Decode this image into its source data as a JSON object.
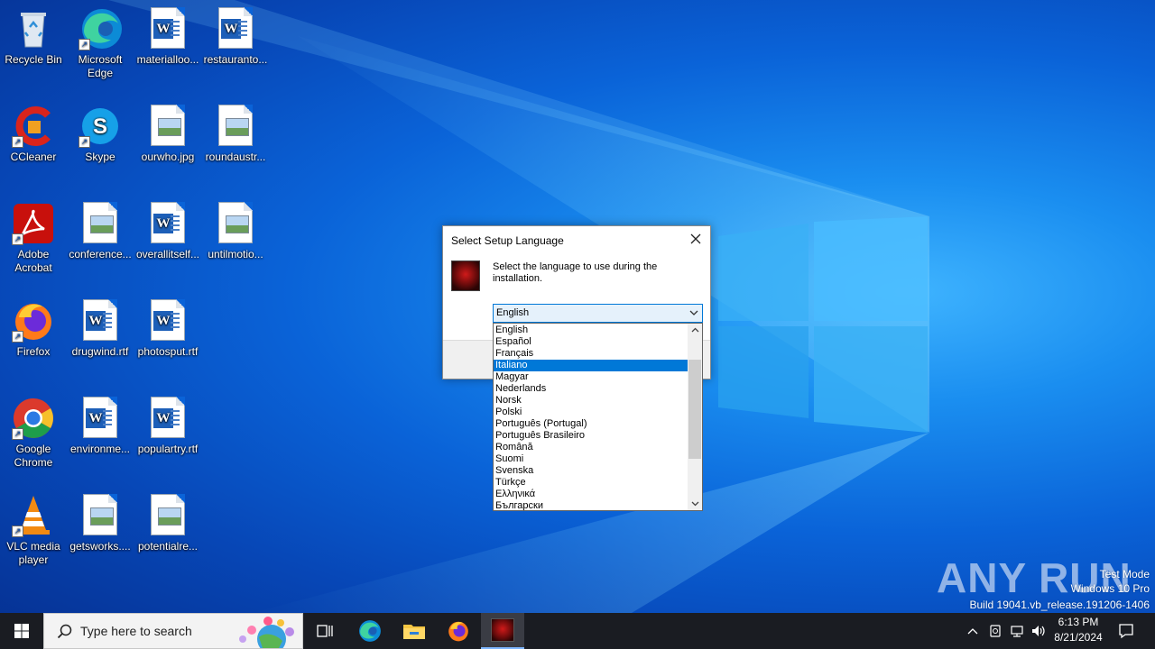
{
  "desktop_icons": [
    {
      "label": "Recycle Bin"
    },
    {
      "label": "Microsoft Edge"
    },
    {
      "label": "materialloo..."
    },
    {
      "label": "restauranto..."
    },
    {
      "label": "CCleaner"
    },
    {
      "label": "Skype"
    },
    {
      "label": "ourwho.jpg"
    },
    {
      "label": "roundaustr..."
    },
    {
      "label": "Adobe Acrobat"
    },
    {
      "label": "conference..."
    },
    {
      "label": "overallitself..."
    },
    {
      "label": "untilmotio..."
    },
    {
      "label": "Firefox"
    },
    {
      "label": "drugwind.rtf"
    },
    {
      "label": "photosput.rtf"
    },
    {
      "label": "Google Chrome"
    },
    {
      "label": "environme..."
    },
    {
      "label": "populartry.rtf"
    },
    {
      "label": "VLC media player"
    },
    {
      "label": "getsworks...."
    },
    {
      "label": "potentialre..."
    }
  ],
  "dialog": {
    "title": "Select Setup Language",
    "message": "Select the language to use during the installation.",
    "selected_value": "English",
    "options": [
      "English",
      "Español",
      "Français",
      "Italiano",
      "Magyar",
      "Nederlands",
      "Norsk",
      "Polski",
      "Português (Portugal)",
      "Português Brasileiro",
      "Română",
      "Suomi",
      "Svenska",
      "Türkçe",
      "Ελληνικά",
      "Български"
    ],
    "highlighted_option": "Italiano"
  },
  "watermark": {
    "brand": "ANY RUN",
    "line1": "Test Mode",
    "line2": "Windows 10 Pro",
    "line3": "Build 19041.vb_release.191206-1406"
  },
  "taskbar": {
    "search_placeholder": "Type here to search",
    "time": "6:13 PM",
    "date": "8/21/2024"
  }
}
